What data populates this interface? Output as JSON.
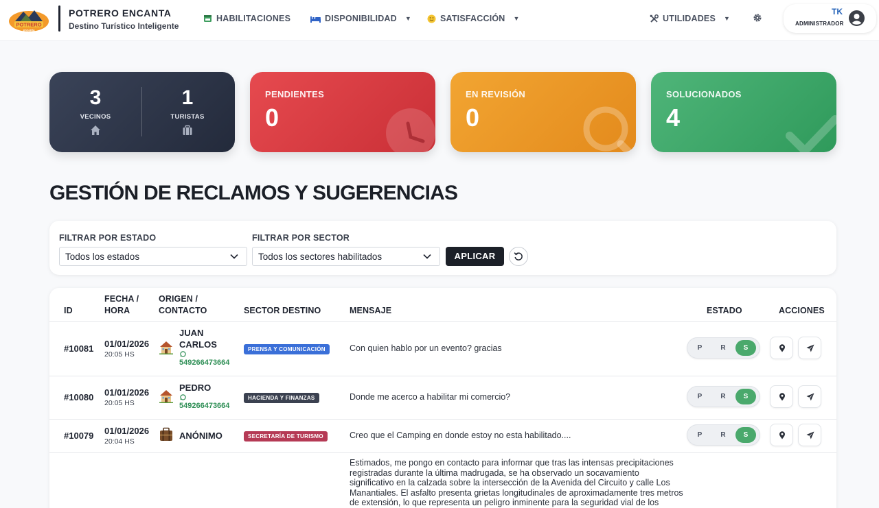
{
  "brand": {
    "title": "POTRERO ENCANTA",
    "subtitle": "Destino Turístico Inteligente",
    "logo_text": "POTRERO",
    "logo_sub": "encanta"
  },
  "nav": [
    {
      "label": "HABILITACIONES",
      "icon": "store-icon",
      "dropdown": false
    },
    {
      "label": "DISPONIBILIDAD",
      "icon": "bed-icon",
      "dropdown": true
    },
    {
      "label": "SATISFACCIÓN",
      "icon": "smile-icon",
      "dropdown": true
    },
    {
      "label": "UTILIDADES",
      "icon": "tools-icon",
      "dropdown": true
    }
  ],
  "user": {
    "initials": "TK",
    "role": "ADMINISTRADOR"
  },
  "stats": {
    "vecinos": {
      "value": "3",
      "label": "VECINOS"
    },
    "turistas": {
      "value": "1",
      "label": "TURISTAS"
    },
    "pendientes": {
      "value": "0",
      "label": "PENDIENTES"
    },
    "revision": {
      "value": "0",
      "label": "EN REVISIÓN"
    },
    "solucionados": {
      "value": "4",
      "label": "SOLUCIONADOS"
    }
  },
  "page_title": "GESTIÓN DE RECLAMOS Y SUGERENCIAS",
  "filters": {
    "estado_label": "FILTRAR POR ESTADO",
    "estado_value": "Todos los estados",
    "sector_label": "FILTRAR POR SECTOR",
    "sector_value": "Todos los sectores habilitados",
    "apply_label": "APLICAR"
  },
  "table": {
    "headers": {
      "id": "ID",
      "fecha_1": "FECHA /",
      "fecha_2": "HORA",
      "origen_1": "ORIGEN /",
      "origen_2": "CONTACTO",
      "sector": "SECTOR DESTINO",
      "mensaje": "MENSAJE",
      "estado": "ESTADO",
      "acciones": "ACCIONES"
    },
    "status_options": [
      "P",
      "R",
      "S"
    ],
    "rows": [
      {
        "id": "#10081",
        "date": "01/01/2026",
        "time": "20:05 HS",
        "origin": "house",
        "name_1": "JUAN",
        "name_2": "CARLOS",
        "phone": "549266473664",
        "sector": "PRENSA Y COMUNICACIÓN",
        "sector_color": "#3a6fd8",
        "message": "Con quien hablo por un evento? gracias",
        "status": "S"
      },
      {
        "id": "#10080",
        "date": "01/01/2026",
        "time": "20:05 HS",
        "origin": "house",
        "name_1": "PEDRO",
        "name_2": "",
        "phone": "549266473664",
        "sector": "HACIENDA Y FINANZAS",
        "sector_color": "#3b4150",
        "message": "Donde me acerco a habilitar mi comercio?",
        "status": "S"
      },
      {
        "id": "#10079",
        "date": "01/01/2026",
        "time": "20:04 HS",
        "origin": "luggage",
        "name_1": "ANÓNIMO",
        "name_2": "",
        "phone": "",
        "sector": "SECRETARÍA DE TURISMO",
        "sector_color": "#b53a55",
        "message": "Creo que el Camping en donde estoy no esta habilitado....",
        "status": "S"
      }
    ],
    "partial_row": {
      "message_lines": [
        "Estimados, me pongo en contacto para informar que tras las intensas precipitaciones",
        "registradas durante la última madrugada, se ha observado un socavamiento",
        "significativo en la calzada sobre la intersección de la Avenida del Circuito y calle Los",
        "Manantiales. El asfalto presenta grietas longitudinales de aproximadamente tres metros",
        "de extensión, lo que representa un peligro inminente para la seguridad vial de los"
      ]
    }
  }
}
